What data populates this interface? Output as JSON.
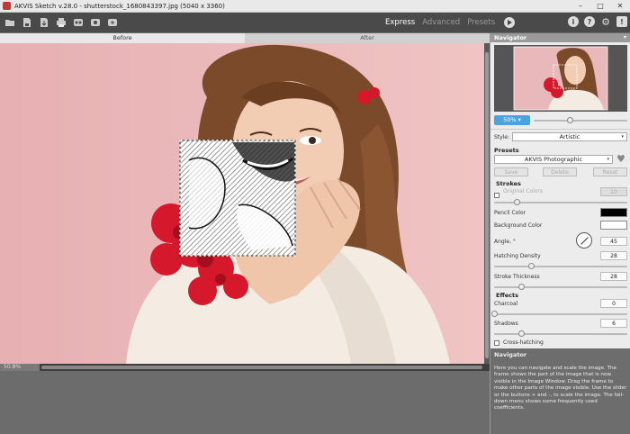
{
  "window": {
    "title": "AKVIS Sketch v.28.0 - shutterstock_1680843397.jpg (5040 x 3360)",
    "controls": [
      "–",
      "□",
      "✕"
    ]
  },
  "toolbar": {
    "icons": [
      "open-icon",
      "save-icon",
      "export-icon",
      "print-icon",
      "share-icon",
      "settings-icon",
      "plugin-icon"
    ],
    "modes": [
      "Express",
      "Advanced",
      "Presets"
    ],
    "active_mode": "Express",
    "right_icons": [
      "info-icon",
      "help-icon",
      "gear-icon",
      "notification-icon"
    ]
  },
  "tabs": {
    "before": "Before",
    "after": "After"
  },
  "canvas": {
    "zoom_label": "50.8%"
  },
  "navigator": {
    "title": "Navigator",
    "zoom": "50%"
  },
  "settings": {
    "style_label": "Style:",
    "style_value": "Artistic",
    "presets_label": "Presets",
    "preset_value": "AKVIS Photographic",
    "preset_buttons": [
      "Save",
      "Delete",
      "Reset"
    ],
    "strokes_label": "Strokes",
    "original_colors": "Original Colors",
    "original_colors_val": "10",
    "pencil_color": "Pencil Color",
    "background_color": "Background Color",
    "angle_label": "Angle, °",
    "angle_val": "45",
    "hatching_density": "Hatching Density",
    "hatching_density_val": "28",
    "stroke_thickness": "Stroke Thickness",
    "stroke_thickness_val": "28",
    "effects_label": "Effects",
    "charcoal": "Charcoal",
    "charcoal_val": "0",
    "shadows": "Shadows",
    "shadows_val": "6",
    "cross_hatching": "Cross-hatching"
  },
  "hint": {
    "title": "Navigator",
    "body": "Here you can navigate and scale the image. The frame shows the part of the image that is now visible in the Image Window. Drag the frame to make other parts of the image visible. Use the slider or the buttons + and -, to scale the image. The fall-down menu shows some frequently used coefficients."
  },
  "colors": {
    "pencil": "#000000",
    "background": "#ffffff",
    "accent": "#4aa3df"
  }
}
